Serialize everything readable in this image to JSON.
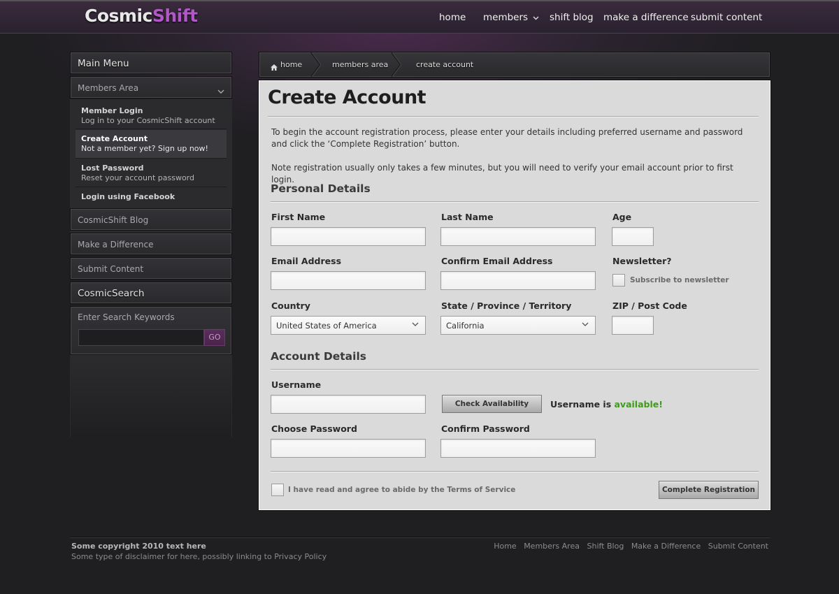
{
  "brand": {
    "name_part1": "Cosmic",
    "name_part2": "Shift"
  },
  "nav": {
    "items": [
      "home",
      "members",
      "shift blog",
      "make a difference",
      "submit content"
    ],
    "dropdown_icon": "chevron-down"
  },
  "sidebar": {
    "main_menu_title": "Main Menu",
    "members_area_label": "Members Area",
    "members_submenu": [
      {
        "title": "Member Login",
        "desc": "Log in to your CosmicShift account"
      },
      {
        "title": "Create Account",
        "desc": "Not a member yet?  Sign up now!"
      },
      {
        "title": "Lost Password",
        "desc": "Reset your account password"
      },
      {
        "title": "Login using Facebook",
        "desc": ""
      }
    ],
    "links": [
      "CosmicShift Blog",
      "Make a Difference",
      "Submit Content"
    ],
    "search_title": "CosmicSearch",
    "search_label": "Enter Search Keywords",
    "search_button": "GO"
  },
  "breadcrumb": [
    "home",
    "members area",
    "create account"
  ],
  "page": {
    "title": "Create Account",
    "intro1": "To begin the account registration process, please enter your details including preferred username and password and click the  ‘Complete Registration’ button.",
    "intro2": "Note registration usually only takes a few minutes, but you will need to verify your email account prior to first login.",
    "personal_title": "Personal Details",
    "labels": {
      "first_name": "First Name",
      "last_name": "Last Name",
      "age": "Age",
      "email": "Email Address",
      "confirm_email": "Confirm Email Address",
      "newsletter": "Newsletter?",
      "newsletter_check": "Subscribe to newsletter",
      "country": "Country",
      "state": "State / Province / Territory",
      "zip": "ZIP / Post Code",
      "username": "Username",
      "choose_password": "Choose Password",
      "confirm_password": "Confirm Password",
      "terms": "I have read and agree to abide by the Terms of Service"
    },
    "country_value": "United States of America",
    "state_value": "California",
    "account_title": "Account Details",
    "check_button": "Check Availability",
    "avail_text": "Username is ",
    "avail_status": "available!",
    "submit_button": "Complete Registration"
  },
  "footer": {
    "copyright": "Some copyright 2010 text here",
    "disclaimer": "Some type of disclaimer for here, possibly linking to Privacy Policy",
    "links": [
      "Home",
      "Members Area",
      "Shift Blog",
      "Make a Difference",
      "Submit Content"
    ]
  },
  "colors": {
    "accent": "#b157c8",
    "available": "#3e9b1c",
    "panel": "#dadada"
  }
}
